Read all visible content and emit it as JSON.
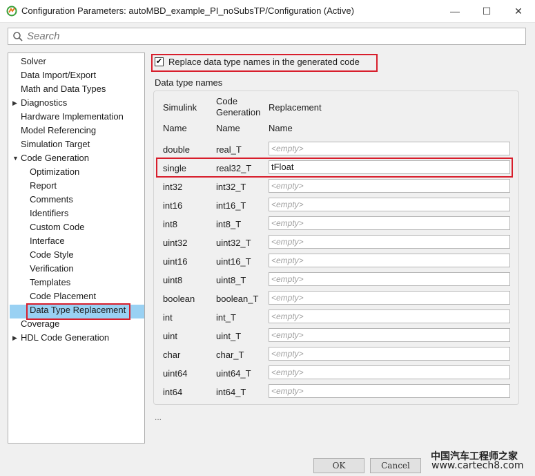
{
  "window": {
    "title": "Configuration Parameters: autoMBD_example_PI_noSubsTP/Configuration (Active)",
    "minimize_glyph": "—",
    "maximize_glyph": "☐",
    "close_glyph": "✕",
    "icon": "matlab-icon"
  },
  "search": {
    "placeholder": "Search",
    "icon": "search-icon"
  },
  "tree": {
    "items": [
      {
        "label": "Solver",
        "level": 0,
        "expander": ""
      },
      {
        "label": "Data Import/Export",
        "level": 0,
        "expander": ""
      },
      {
        "label": "Math and Data Types",
        "level": 0,
        "expander": ""
      },
      {
        "label": "Diagnostics",
        "level": 0,
        "expander": "collapsed"
      },
      {
        "label": "Hardware Implementation",
        "level": 0,
        "expander": ""
      },
      {
        "label": "Model Referencing",
        "level": 0,
        "expander": ""
      },
      {
        "label": "Simulation Target",
        "level": 0,
        "expander": ""
      },
      {
        "label": "Code Generation",
        "level": 0,
        "expander": "expanded"
      },
      {
        "label": "Optimization",
        "level": 1,
        "expander": ""
      },
      {
        "label": "Report",
        "level": 1,
        "expander": ""
      },
      {
        "label": "Comments",
        "level": 1,
        "expander": ""
      },
      {
        "label": "Identifiers",
        "level": 1,
        "expander": ""
      },
      {
        "label": "Custom Code",
        "level": 1,
        "expander": ""
      },
      {
        "label": "Interface",
        "level": 1,
        "expander": ""
      },
      {
        "label": "Code Style",
        "level": 1,
        "expander": ""
      },
      {
        "label": "Verification",
        "level": 1,
        "expander": ""
      },
      {
        "label": "Templates",
        "level": 1,
        "expander": ""
      },
      {
        "label": "Code Placement",
        "level": 1,
        "expander": ""
      },
      {
        "label": "Data Type Replacement",
        "level": 1,
        "expander": "",
        "selected": true
      },
      {
        "label": "Coverage",
        "level": 0,
        "expander": ""
      },
      {
        "label": "HDL Code Generation",
        "level": 0,
        "expander": "collapsed"
      }
    ],
    "selection_color": "#99d1f3"
  },
  "panel": {
    "checkbox": {
      "label": "Replace data type names in the generated code",
      "checked": true
    },
    "group_title": "Data type names",
    "headers": {
      "col1_line1": "Simulink",
      "col1_line2": "Name",
      "col2_line1": "Code",
      "col2_line2": "Generation",
      "col2_line3": "Name",
      "col3_line1": "Replacement",
      "col3_line2": "Name"
    },
    "rows": [
      {
        "simulink": "double",
        "codegen": "real_T",
        "replacement": "",
        "placeholder": "<empty>"
      },
      {
        "simulink": "single",
        "codegen": "real32_T",
        "replacement": "tFloat",
        "placeholder": "<empty>"
      },
      {
        "simulink": "int32",
        "codegen": "int32_T",
        "replacement": "",
        "placeholder": "<empty>"
      },
      {
        "simulink": "int16",
        "codegen": "int16_T",
        "replacement": "",
        "placeholder": "<empty>"
      },
      {
        "simulink": "int8",
        "codegen": "int8_T",
        "replacement": "",
        "placeholder": "<empty>"
      },
      {
        "simulink": "uint32",
        "codegen": "uint32_T",
        "replacement": "",
        "placeholder": "<empty>"
      },
      {
        "simulink": "uint16",
        "codegen": "uint16_T",
        "replacement": "",
        "placeholder": "<empty>"
      },
      {
        "simulink": "uint8",
        "codegen": "uint8_T",
        "replacement": "",
        "placeholder": "<empty>"
      },
      {
        "simulink": "boolean",
        "codegen": "boolean_T",
        "replacement": "",
        "placeholder": "<empty>"
      },
      {
        "simulink": "int",
        "codegen": "int_T",
        "replacement": "",
        "placeholder": "<empty>"
      },
      {
        "simulink": "uint",
        "codegen": "uint_T",
        "replacement": "",
        "placeholder": "<empty>"
      },
      {
        "simulink": "char",
        "codegen": "char_T",
        "replacement": "",
        "placeholder": "<empty>"
      },
      {
        "simulink": "uint64",
        "codegen": "uint64_T",
        "replacement": "",
        "placeholder": "<empty>"
      },
      {
        "simulink": "int64",
        "codegen": "int64_T",
        "replacement": "",
        "placeholder": "<empty>"
      }
    ],
    "ellipsis": "..."
  },
  "buttons": {
    "ok": "OK",
    "cancel": "Cancel"
  },
  "watermark": {
    "line1": "中国汽车工程师之家",
    "line2": "www.cartech8.com"
  },
  "colors": {
    "highlight_red": "#d81e2c",
    "selection_blue": "#99d1f3"
  }
}
